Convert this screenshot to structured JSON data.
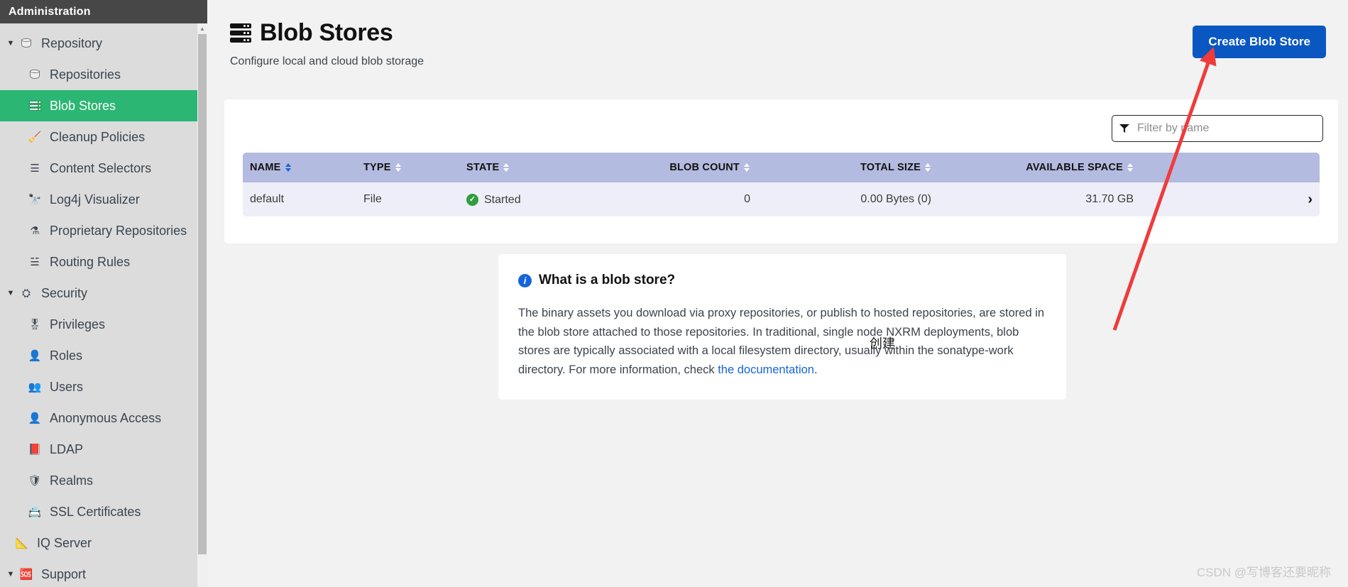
{
  "sidebar": {
    "header_title": "Administration",
    "accent_selected": "#2bb673",
    "items": [
      {
        "label": "Repository",
        "icon": "database-icon",
        "level": "group",
        "caret": "▼",
        "glyph": "db",
        "selected": false
      },
      {
        "label": "Repositories",
        "icon": "database-icon",
        "level": "child",
        "caret": "",
        "glyph": "db",
        "selected": false
      },
      {
        "label": "Blob Stores",
        "icon": "server-stack-icon",
        "level": "child",
        "caret": "",
        "glyph": "stack",
        "selected": true
      },
      {
        "label": "Cleanup Policies",
        "icon": "broom-icon",
        "level": "child",
        "caret": "",
        "glyph": "🧹",
        "selected": false
      },
      {
        "label": "Content Selectors",
        "icon": "layers-icon",
        "level": "child",
        "caret": "",
        "glyph": "☰",
        "selected": false
      },
      {
        "label": "Log4j Visualizer",
        "icon": "binoculars-icon",
        "level": "child",
        "caret": "",
        "glyph": "🔭",
        "selected": false
      },
      {
        "label": "Proprietary Repositories",
        "icon": "proprietary-icon",
        "level": "child",
        "caret": "",
        "glyph": "⚗",
        "selected": false
      },
      {
        "label": "Routing Rules",
        "icon": "signpost-icon",
        "level": "child",
        "caret": "",
        "glyph": "☱",
        "selected": false
      },
      {
        "label": "Security",
        "icon": "shield-user-icon",
        "level": "group",
        "caret": "▼",
        "glyph": "⛭",
        "selected": false
      },
      {
        "label": "Privileges",
        "icon": "medal-icon",
        "level": "child",
        "caret": "",
        "glyph": "🎖",
        "selected": false
      },
      {
        "label": "Roles",
        "icon": "person-badge-icon",
        "level": "child",
        "caret": "",
        "glyph": "👤",
        "selected": false
      },
      {
        "label": "Users",
        "icon": "users-icon",
        "level": "child",
        "caret": "",
        "glyph": "👥",
        "selected": false
      },
      {
        "label": "Anonymous Access",
        "icon": "anonymous-user-icon",
        "level": "child",
        "caret": "",
        "glyph": "👤",
        "selected": false
      },
      {
        "label": "LDAP",
        "icon": "address-book-icon",
        "level": "child",
        "caret": "",
        "glyph": "📕",
        "selected": false
      },
      {
        "label": "Realms",
        "icon": "shield-icon",
        "level": "child",
        "caret": "",
        "glyph": "🛡",
        "selected": false
      },
      {
        "label": "SSL Certificates",
        "icon": "certificate-icon",
        "level": "child",
        "caret": "",
        "glyph": "📇",
        "selected": false
      },
      {
        "label": "IQ Server",
        "icon": "iq-server-icon",
        "level": "sub",
        "caret": "",
        "glyph": "📐",
        "selected": false
      },
      {
        "label": "Support",
        "icon": "lifebuoy-icon",
        "level": "group",
        "caret": "▼",
        "glyph": "🆘",
        "selected": false
      }
    ]
  },
  "header": {
    "title": "Blob Stores",
    "title_icon": "server-stack-icon",
    "subtitle": "Configure local and cloud blob storage",
    "create_button_label": "Create Blob Store",
    "create_button_color": "#0a57c2"
  },
  "table_card": {
    "filter": {
      "icon": "funnel-icon",
      "placeholder": "Filter by name",
      "value": ""
    },
    "columns": [
      {
        "label": "NAME",
        "align": "left",
        "sorted": true,
        "sort_dir": "asc"
      },
      {
        "label": "TYPE",
        "align": "left",
        "sorted": false,
        "sort_dir": ""
      },
      {
        "label": "STATE",
        "align": "left",
        "sorted": false,
        "sort_dir": ""
      },
      {
        "label": "BLOB COUNT",
        "align": "right",
        "sorted": false,
        "sort_dir": ""
      },
      {
        "label": "TOTAL SIZE",
        "align": "right",
        "sorted": false,
        "sort_dir": ""
      },
      {
        "label": "AVAILABLE SPACE",
        "align": "right",
        "sorted": false,
        "sort_dir": ""
      },
      {
        "label": "",
        "align": "right",
        "sorted": false,
        "sort_dir": ""
      }
    ],
    "rows": [
      {
        "name": "default",
        "type": "File",
        "state": "Started",
        "state_icon": "check-circle-icon",
        "blob_count": "0",
        "total_size": "0.00 Bytes (0)",
        "available_space": "31.70 GB",
        "chevron": "›"
      }
    ]
  },
  "info_panel": {
    "icon": "info-circle-icon",
    "title": "What is a blob store?",
    "body_part_1": "The binary assets you download via proxy repositories, or publish to hosted repositories, are stored in the blob store attached to those repositories. In traditional, single node NXRM deployments, blob stores are typically associated with a local filesystem directory, usually within the sonatype-work directory. For more information, check ",
    "link_text": "the documentation",
    "body_part_2": "."
  },
  "annotations": {
    "callout_label": "创建",
    "arrow_color": "#ef3b3b",
    "watermark": "CSDN @写博客还要昵称"
  }
}
